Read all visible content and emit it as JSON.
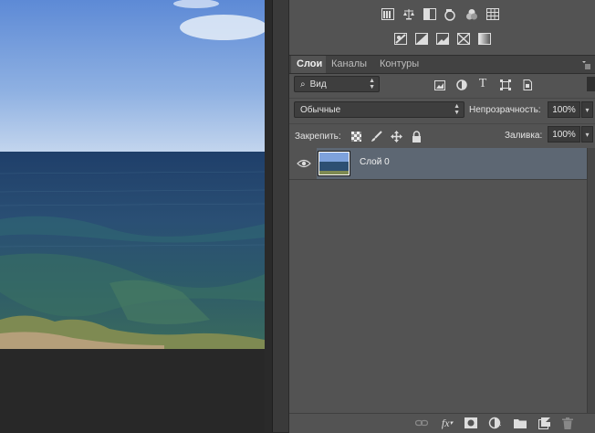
{
  "tabs": [
    {
      "label": "Слои",
      "active": true
    },
    {
      "label": "Каналы",
      "active": false
    },
    {
      "label": "Контуры",
      "active": false
    }
  ],
  "filter": {
    "label": "Вид"
  },
  "blend": {
    "mode": "Обычные"
  },
  "opacity": {
    "label": "Непрозрачность:",
    "value": "100%"
  },
  "lock": {
    "label": "Закрепить:"
  },
  "fill": {
    "label": "Заливка:",
    "value": "100%"
  },
  "layers": [
    {
      "name": "Слой 0",
      "visible": true,
      "selected": true
    }
  ],
  "colors": {
    "panel_bg": "#535353",
    "selected_layer": "#5d6773",
    "workspace": "#282828"
  },
  "icons": {
    "adjustments_row1": [
      "brightness-contrast-icon",
      "levels-icon",
      "curves-icon",
      "exposure-icon",
      "vibrance-icon",
      "color-lookup-icon"
    ],
    "adjustments_row2": [
      "invert-icon",
      "posterize-icon",
      "threshold-icon",
      "selective-color-icon",
      "gradient-map-icon"
    ],
    "filter_types": [
      "pixel-layer-filter-icon",
      "adjustment-layer-filter-icon",
      "type-layer-filter-icon",
      "shape-layer-filter-icon",
      "smart-object-filter-icon"
    ],
    "locks": [
      "lock-transparency-icon",
      "lock-paint-icon",
      "lock-position-icon",
      "lock-all-icon"
    ],
    "bottom": [
      "link-layers-icon",
      "fx-icon",
      "add-mask-icon",
      "new-adjustment-icon",
      "new-group-icon",
      "new-layer-icon",
      "delete-layer-icon"
    ]
  }
}
